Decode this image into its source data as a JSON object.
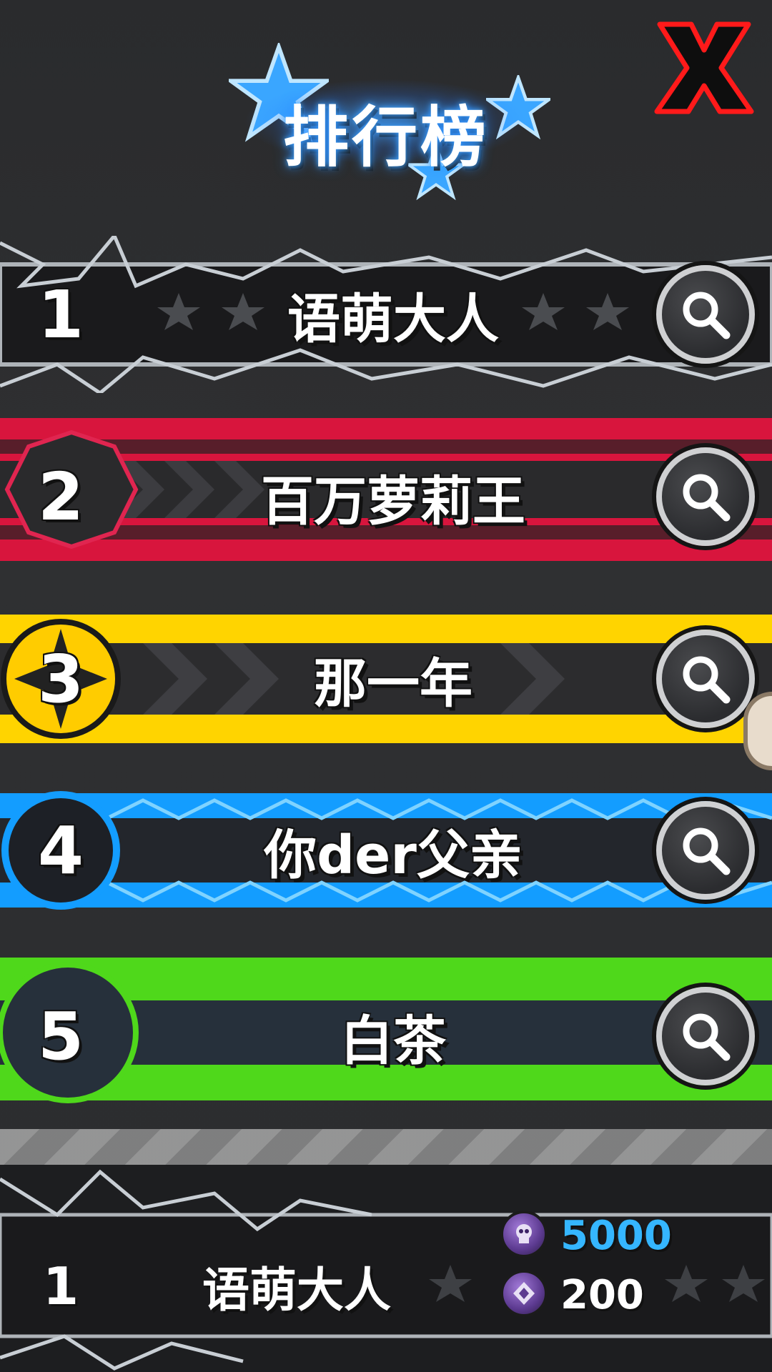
{
  "header": {
    "title": "排行榜",
    "close_icon": "close-x-icon"
  },
  "leaderboard": {
    "rows": [
      {
        "rank": "1",
        "name": "语萌大人",
        "theme": "silver",
        "color": "#9fa3a8"
      },
      {
        "rank": "2",
        "name": "百万萝莉王",
        "theme": "red",
        "color": "#e8234a"
      },
      {
        "rank": "3",
        "name": "那一年",
        "theme": "yellow",
        "color": "#ffd400"
      },
      {
        "rank": "4",
        "name": "你der父亲",
        "theme": "blue",
        "color": "#1aa3ff"
      },
      {
        "rank": "5",
        "name": "白茶",
        "theme": "green",
        "color": "#52e01a"
      }
    ],
    "search_icon": "magnifier-icon"
  },
  "my_entry": {
    "rank": "1",
    "name": "语萌大人",
    "currency_primary": {
      "icon": "purple-skull-coin-icon",
      "value": "5000",
      "color": "#35b6ff"
    },
    "currency_secondary": {
      "icon": "purple-gem-coin-icon",
      "value": "200",
      "color": "#ffffff"
    }
  }
}
